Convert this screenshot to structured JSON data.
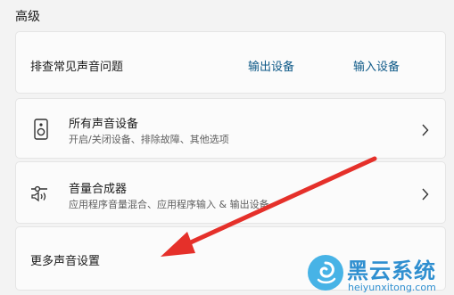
{
  "section": {
    "title": "高级"
  },
  "troubleshoot": {
    "label": "排查常见声音问题",
    "output_link": "输出设备",
    "input_link": "输入设备"
  },
  "all_devices": {
    "title": "所有声音设备",
    "subtitle": "开启/关闭设备、排除故障、其他选项",
    "icon": "speaker-icon"
  },
  "mixer": {
    "title": "音量合成器",
    "subtitle": "应用程序音量混合、应用程序输入 & 输出设备",
    "icon": "volume-mixer-icon"
  },
  "more": {
    "label": "更多声音设置"
  },
  "annotation": {
    "color": "#e5302a"
  },
  "watermark": {
    "text": "黑云系统",
    "url": "heiyunxitong.com"
  },
  "colors": {
    "link": "#0f5a88",
    "background": "#f3f3f3",
    "card": "#fbfbfb"
  }
}
